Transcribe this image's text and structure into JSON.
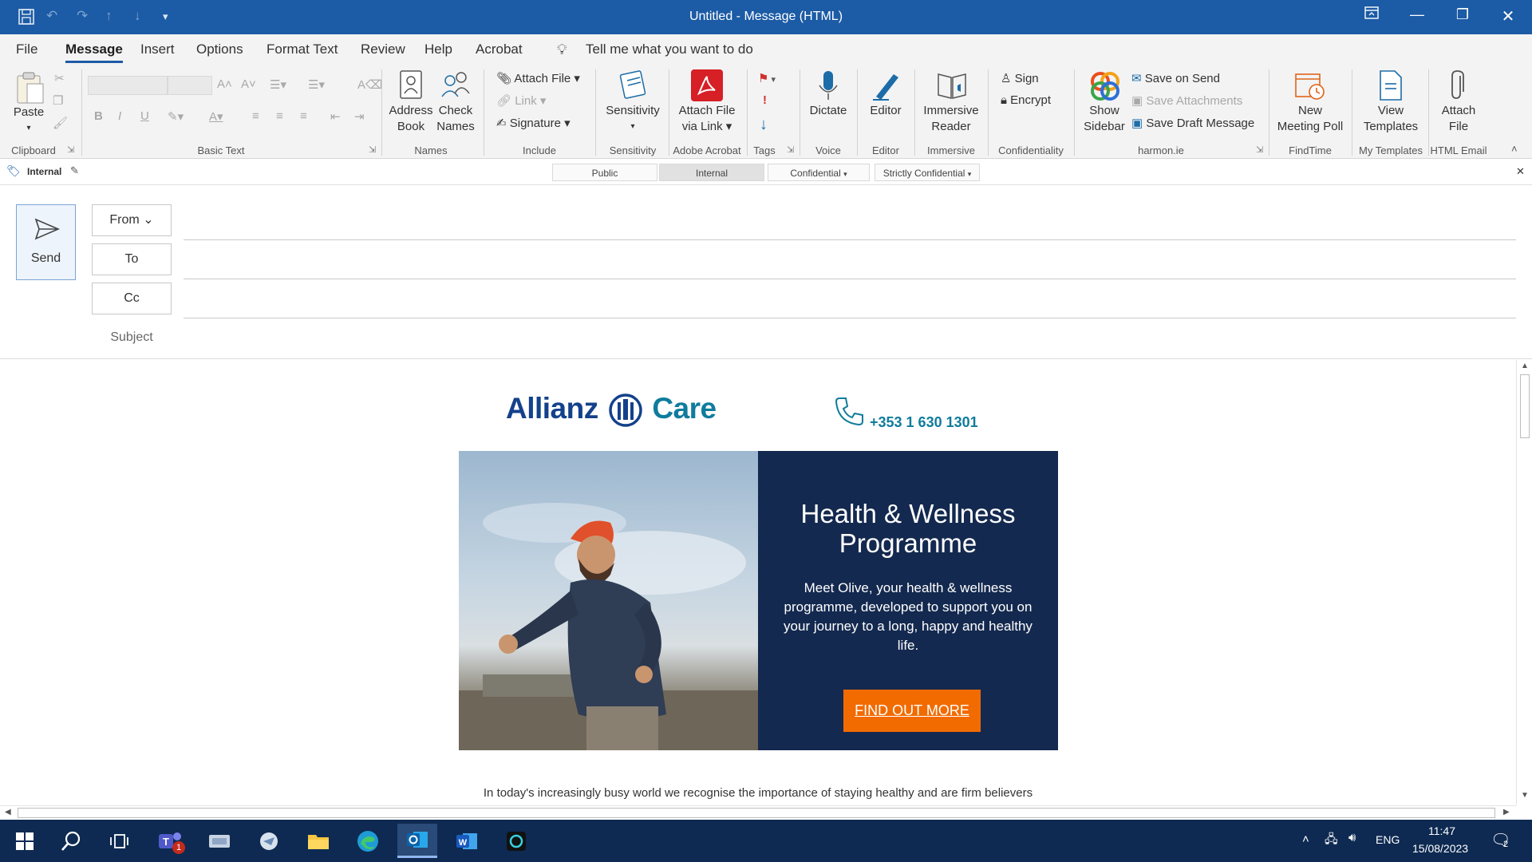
{
  "window": {
    "title": "Untitled  -  Message (HTML)"
  },
  "menu": {
    "items": [
      "File",
      "Message",
      "Insert",
      "Options",
      "Format Text",
      "Review",
      "Help",
      "Acrobat"
    ],
    "active": "Message",
    "tell_me": "Tell me what you want to do"
  },
  "ribbon": {
    "clipboard": {
      "paste": "Paste",
      "group": "Clipboard"
    },
    "basic_text": {
      "group": "Basic Text"
    },
    "names": {
      "address_book_1": "Address",
      "address_book_2": "Book",
      "check_names_1": "Check",
      "check_names_2": "Names",
      "group": "Names"
    },
    "include": {
      "attach_file": "Attach File",
      "link": "Link",
      "signature": "Signature",
      "group": "Include"
    },
    "sensitivity": {
      "label": "Sensitivity",
      "group": "Sensitivity"
    },
    "adobe": {
      "line1": "Attach File",
      "line2": "via Link",
      "group": "Adobe Acrobat"
    },
    "tags": {
      "group": "Tags"
    },
    "voice": {
      "dictate": "Dictate",
      "group": "Voice"
    },
    "editor": {
      "label": "Editor",
      "group": "Editor"
    },
    "immersive": {
      "line1": "Immersive",
      "line2": "Reader",
      "group": "Immersive"
    },
    "confidentiality": {
      "sign": "Sign",
      "encrypt": "Encrypt",
      "group": "Confidentiality"
    },
    "harmon": {
      "show_1": "Show",
      "show_2": "Sidebar",
      "save_on_send": "Save on Send",
      "save_attachments": "Save Attachments",
      "save_draft": "Save Draft Message",
      "group": "harmon.ie"
    },
    "findtime": {
      "line1": "New",
      "line2": "Meeting Poll",
      "group": "FindTime"
    },
    "templates": {
      "line1": "View",
      "line2": "Templates",
      "group": "My Templates"
    },
    "html_email": {
      "line1": "Attach",
      "line2": "File",
      "group": "HTML Email"
    }
  },
  "classification": {
    "current": "Internal",
    "options": [
      "Public",
      "Internal",
      "Confidential",
      "Strictly Confidential"
    ],
    "selected": "Internal"
  },
  "compose": {
    "send": "Send",
    "from": "From",
    "to": "To",
    "cc": "Cc",
    "subject": "Subject"
  },
  "email": {
    "brand": "Allianz",
    "brand_suffix": "Care",
    "phone": "+353 1 630 1301",
    "headline": "Health & Wellness Programme",
    "body": "Meet Olive, your health & wellness programme, developed to support you on your journey to a long, happy and healthy life.",
    "cta": "FIND OUT MORE",
    "intro": "In today's increasingly busy world we recognise the importance of staying healthy and are firm believers",
    "colors": {
      "navy": "#14294f",
      "orange": "#f26b00",
      "brand_blue": "#14418b",
      "teal": "#0f7c9c"
    }
  },
  "taskbar": {
    "apps": [
      "windows-start",
      "search",
      "task-view",
      "teams",
      "app-1",
      "app-2",
      "file-explorer",
      "edge",
      "outlook",
      "word",
      "app-3"
    ],
    "teams_badge": "1",
    "lang": "ENG",
    "time": "11:47",
    "date": "15/08/2023",
    "notif_count": "2"
  }
}
